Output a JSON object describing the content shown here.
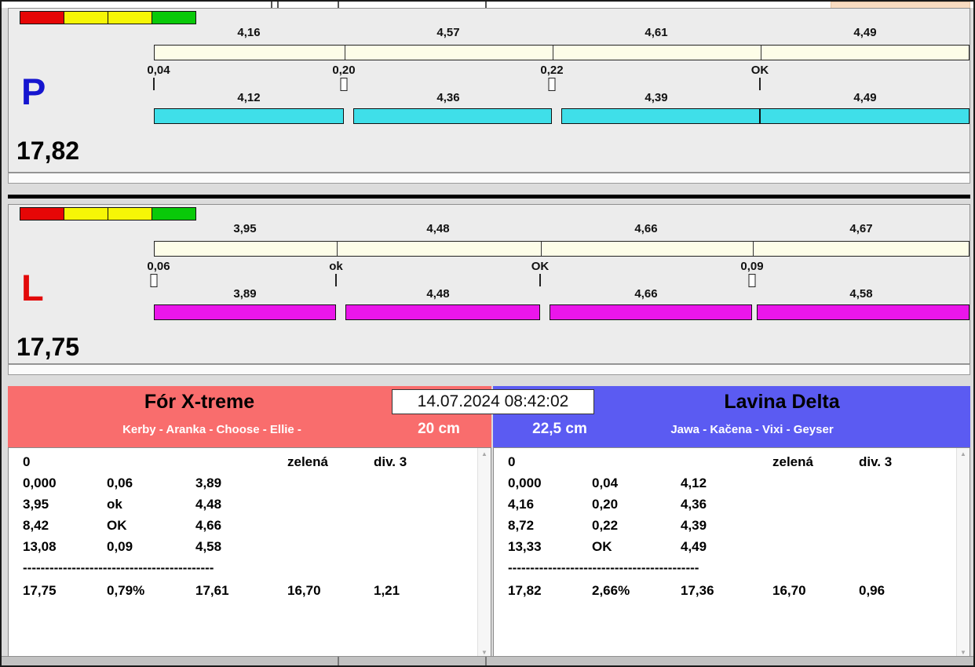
{
  "legend": {
    "colors": [
      "#e60606",
      "#f6f606",
      "#f6f606",
      "#09c909"
    ]
  },
  "lanes": {
    "p": {
      "letter": "P",
      "letter_color": "#1515cf",
      "total": "17,82",
      "split_times": [
        "4,16",
        "4,57",
        "4,61",
        "4,49"
      ],
      "gate_times": [
        "0,04",
        "0,20",
        "0,22",
        "OK"
      ],
      "leg_times": [
        "4,12",
        "4,36",
        "4,39",
        "4,49"
      ],
      "bar_color": "#3fdfe9"
    },
    "l": {
      "letter": "L",
      "letter_color": "#e20a0a",
      "total": "17,75",
      "split_times": [
        "3,95",
        "4,48",
        "4,66",
        "4,67"
      ],
      "gate_times": [
        "0,06",
        "ok",
        "OK",
        "0,09"
      ],
      "leg_times": [
        "3,89",
        "4,48",
        "4,66",
        "4,58"
      ],
      "bar_color": "#ea16ea"
    }
  },
  "datetime": "14.07.2024 08:42:02",
  "teams": {
    "left": {
      "name": "Fór X-treme",
      "members": "Kerby - Aranka - Choose - Ellie -",
      "height": "20 cm",
      "header_color": "#f96d6d",
      "rows": [
        {
          "c0": "0",
          "c3": "zelená",
          "c4": "div. 3"
        },
        {
          "c0": "0,000",
          "c1": "0,06",
          "c2": "3,89"
        },
        {
          "c0": "3,95",
          "c1": "ok",
          "c2": "4,48"
        },
        {
          "c0": "8,42",
          "c1": "OK",
          "c2": "4,66"
        },
        {
          "c0": "13,08",
          "c1": "0,09",
          "c2": "4,58"
        }
      ],
      "separator": "-------------------------------------------",
      "summary": {
        "c0": "17,75",
        "c1": "0,79%",
        "c2": "17,61",
        "c3": "16,70",
        "c4": "1,21"
      }
    },
    "right": {
      "name": "Lavina Delta",
      "members": "Jawa - Kačena - Vixi - Geyser",
      "height": "22,5 cm",
      "header_color": "#5b5bf2",
      "rows": [
        {
          "c0": "0",
          "c3": "zelená",
          "c4": "div. 3"
        },
        {
          "c0": "0,000",
          "c1": "0,04",
          "c2": "4,12"
        },
        {
          "c0": "4,16",
          "c1": "0,20",
          "c2": "4,36"
        },
        {
          "c0": "8,72",
          "c1": "0,22",
          "c2": "4,39"
        },
        {
          "c0": "13,33",
          "c1": "OK",
          "c2": "4,49"
        }
      ],
      "separator": "-------------------------------------------",
      "summary": {
        "c0": "17,82",
        "c1": "2,66%",
        "c2": "17,36",
        "c3": "16,70",
        "c4": "0,96"
      }
    }
  }
}
